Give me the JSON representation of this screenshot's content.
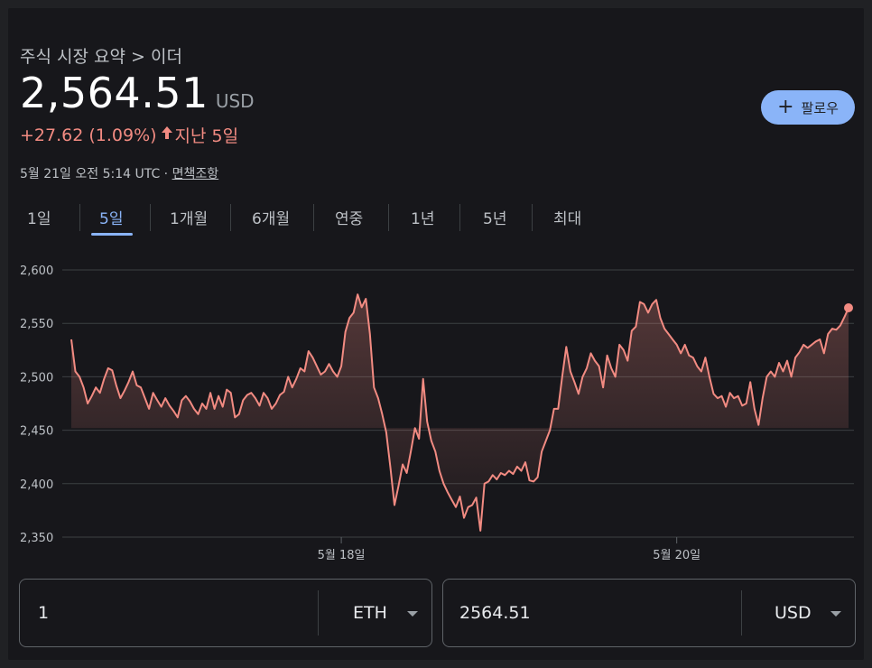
{
  "header": {
    "breadcrumb": "주식 시장 요약 > 이더",
    "price": "2,564.51",
    "currency": "USD",
    "change": "+27.62 (1.09%)",
    "change_period": "지난 5일",
    "timestamp": "5월 21일 오전 5:14 UTC · ",
    "disclaimer": "면책조항"
  },
  "follow_button": {
    "label": "팔로우"
  },
  "tabs": [
    {
      "label": "1일"
    },
    {
      "label": "5일"
    },
    {
      "label": "1개월"
    },
    {
      "label": "6개월"
    },
    {
      "label": "연중"
    },
    {
      "label": "1년"
    },
    {
      "label": "5년"
    },
    {
      "label": "최대"
    }
  ],
  "active_tab": "5일",
  "colors": {
    "line": "#f28b82",
    "accent": "#8ab4f8",
    "grid": "#3c4043"
  },
  "chart_data": {
    "type": "area",
    "title": "",
    "ylim": [
      2350,
      2600
    ],
    "yticks": [
      "2,600",
      "2,550",
      "2,500",
      "2,450",
      "2,400",
      "2,350"
    ],
    "yticks_values": [
      2600,
      2550,
      2500,
      2450,
      2400,
      2350
    ],
    "xticks": [
      {
        "label": "5월 18일",
        "index": 66
      },
      {
        "label": "5월 20일",
        "index": 148
      }
    ],
    "baseline": 2452,
    "grid": true,
    "series": [
      {
        "values": [
          2535,
          2505,
          2500,
          2490,
          2475,
          2482,
          2490,
          2485,
          2498,
          2508,
          2506,
          2492,
          2480,
          2487,
          2495,
          2505,
          2492,
          2490,
          2480,
          2470,
          2485,
          2478,
          2472,
          2480,
          2473,
          2468,
          2462,
          2478,
          2482,
          2477,
          2470,
          2465,
          2475,
          2470,
          2485,
          2470,
          2482,
          2472,
          2488,
          2485,
          2462,
          2465,
          2478,
          2483,
          2485,
          2480,
          2473,
          2485,
          2480,
          2470,
          2475,
          2483,
          2486,
          2500,
          2490,
          2498,
          2508,
          2505,
          2524,
          2518,
          2510,
          2502,
          2505,
          2512,
          2505,
          2500,
          2510,
          2542,
          2555,
          2560,
          2577,
          2565,
          2573,
          2540,
          2490,
          2480,
          2465,
          2448,
          2415,
          2380,
          2398,
          2418,
          2410,
          2430,
          2452,
          2442,
          2498,
          2458,
          2440,
          2430,
          2412,
          2400,
          2392,
          2385,
          2378,
          2388,
          2368,
          2378,
          2380,
          2387,
          2356,
          2400,
          2402,
          2408,
          2404,
          2410,
          2408,
          2412,
          2409,
          2416,
          2412,
          2420,
          2403,
          2402,
          2406,
          2430,
          2440,
          2450,
          2470,
          2470,
          2500,
          2528,
          2505,
          2495,
          2484,
          2500,
          2508,
          2522,
          2515,
          2510,
          2490,
          2520,
          2508,
          2500,
          2530,
          2525,
          2515,
          2543,
          2547,
          2570,
          2568,
          2560,
          2568,
          2572,
          2555,
          2545,
          2540,
          2535,
          2530,
          2522,
          2530,
          2520,
          2518,
          2510,
          2505,
          2518,
          2500,
          2484,
          2480,
          2482,
          2472,
          2485,
          2480,
          2482,
          2473,
          2475,
          2495,
          2470,
          2455,
          2480,
          2500,
          2505,
          2500,
          2513,
          2505,
          2515,
          2500,
          2518,
          2523,
          2530,
          2527,
          2530,
          2533,
          2535,
          2522,
          2540,
          2545,
          2544,
          2548,
          2556,
          2564.51
        ]
      }
    ]
  },
  "converter": {
    "from_value": "1",
    "from_unit": "ETH",
    "to_value": "2564.51",
    "to_unit": "USD"
  }
}
